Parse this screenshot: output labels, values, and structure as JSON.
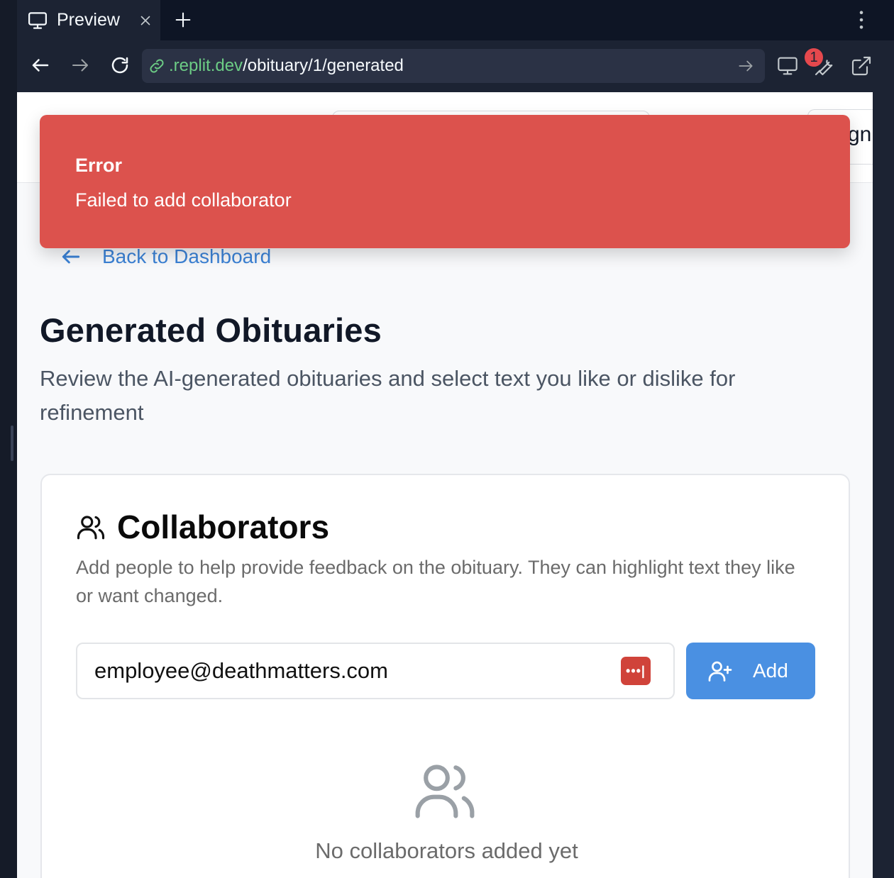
{
  "browser": {
    "tab_label": "Preview",
    "url_domain": ".replit.dev",
    "url_path": "/obituary/1/generated",
    "notification_count": "1"
  },
  "header": {
    "button_partial_label": "gn"
  },
  "toast": {
    "title": "Error",
    "message": "Failed to add collaborator",
    "color": "#dc524d"
  },
  "page": {
    "back_label": "Back to Dashboard",
    "title": "Generated Obituaries",
    "subtitle": "Review the AI-generated obituaries and select text you like or dislike for refinement"
  },
  "collaborators": {
    "title": "Collaborators",
    "description": "Add people to help provide feedback on the obituary. They can highlight text they like or want changed.",
    "email_value": "employee@deathmatters.com",
    "password_manager_glyph": "•••|",
    "add_label": "Add",
    "empty_title": "No collaborators added yet"
  },
  "colors": {
    "accent": "#4a90e2",
    "link": "#3b82d6",
    "url_domain": "#6ccc85"
  }
}
